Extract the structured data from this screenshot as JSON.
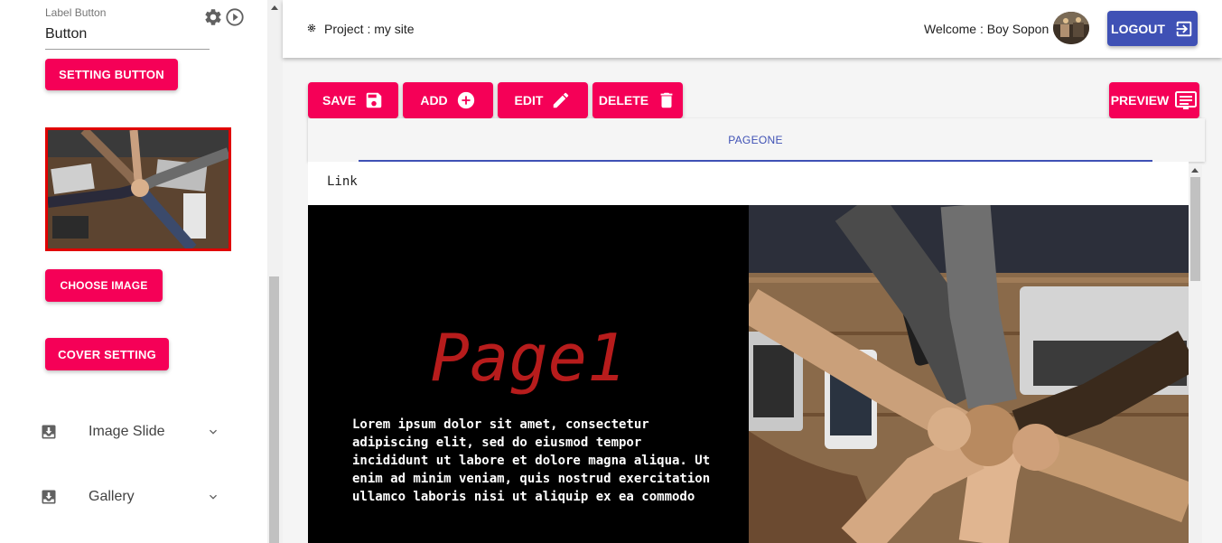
{
  "sidebar": {
    "label_field": {
      "label": "Label Button",
      "value": "Button"
    },
    "setting_button": "SETTING BUTTON",
    "choose_image_button": "CHOOSE IMAGE",
    "cover_setting_button": "COVER SETTING",
    "accordion": [
      {
        "label": "Image Slide",
        "icon": "download-box-icon"
      },
      {
        "label": "Gallery",
        "icon": "download-box-icon"
      }
    ]
  },
  "header": {
    "project": "Project : my site",
    "welcome": "Welcome : Boy Sopon",
    "logout": "LOGOUT"
  },
  "toolbar": {
    "save": "SAVE",
    "add": "ADD",
    "edit": "EDIT",
    "delete": "DELETE",
    "preview": "PREVIEW"
  },
  "tabs": [
    {
      "label": "PAGEONE",
      "active": true
    }
  ],
  "page": {
    "link": "Link",
    "title": "Page1",
    "body_lines": [
      "Lorem ipsum dolor sit amet, consectetur",
      "adipiscing elit, sed do eiusmod tempor",
      "incididunt ut labore et dolore magna aliqua. Ut",
      "enim ad minim veniam, quis nostrud exercitation",
      "ullamco laboris nisi ut aliquip ex ea commodo"
    ]
  },
  "colors": {
    "accent_pink": "#f50057",
    "primary_indigo": "#3f51b5",
    "title_red": "#b71c1c",
    "selected_border": "#e00000"
  }
}
